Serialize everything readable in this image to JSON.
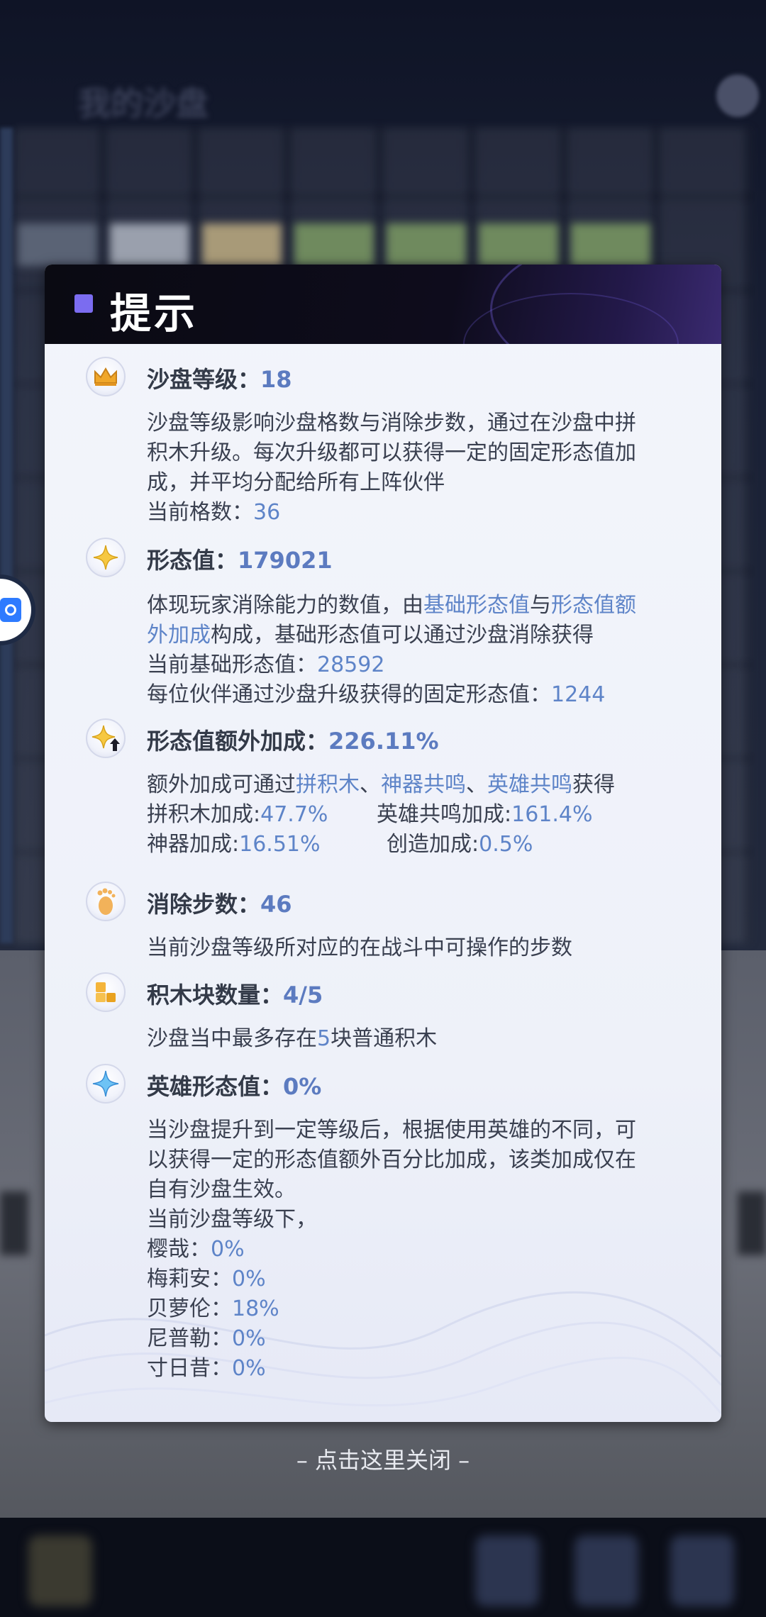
{
  "background": {
    "title": "我的沙盘",
    "help_icon": "question-icon"
  },
  "dialog": {
    "title": "提示",
    "sections": [
      {
        "icon": "crown-icon",
        "label": "沙盘等级：",
        "value": "18",
        "lines": [
          [
            "沙盘等级影响沙盘格数与消除步数，通过在沙盘中拼"
          ],
          [
            "积木升级。每次升级都可以获得一定的固定形态值加"
          ],
          [
            "成，并平均分配给所有上阵伙伴"
          ],
          [
            "当前格数：",
            "36"
          ]
        ]
      },
      {
        "icon": "sparkle-icon",
        "label": "形态值：",
        "value": "179021",
        "line1": {
          "a": "体现玩家消除能力的数值，由",
          "b": "基础形态值",
          "c": "与",
          "d": "形态值额"
        },
        "line2": {
          "a": "外加成",
          "b": "构成，基础形态值可以通过沙盘消除获得"
        },
        "line3": {
          "label": "当前基础形态值：",
          "value": "28592"
        },
        "line4": {
          "label": "每位伙伴通过沙盘升级获得的固定形态值：",
          "value": "1244"
        }
      },
      {
        "icon": "sparkle-up-icon",
        "label": "形态值额外加成：",
        "value": "226.11%",
        "line1": {
          "a": "额外加成可通过",
          "b": "拼积木",
          "c": "、",
          "d": "神器共鸣",
          "e": "、",
          "f": "英雄共鸣",
          "g": "获得"
        },
        "stats": [
          {
            "label": "拼积木加成:",
            "value": "47.7%"
          },
          {
            "label": "英雄共鸣加成:",
            "value": "161.4%"
          },
          {
            "label": "神器加成:",
            "value": "16.51%"
          },
          {
            "label": "创造加成:",
            "value": "0.5%"
          }
        ]
      },
      {
        "icon": "footprint-icon",
        "label": "消除步数：",
        "value": "46",
        "line1": "当前沙盘等级所对应的在战斗中可操作的步数"
      },
      {
        "icon": "blocks-icon",
        "label": "积木块数量：",
        "value": "4/5",
        "line1": {
          "a": "沙盘当中最多存在",
          "b": "5",
          "c": "块普通积木"
        }
      },
      {
        "icon": "star-crystal-icon",
        "label": "英雄形态值：",
        "value": "0%",
        "lines": [
          "当沙盘提升到一定等级后，根据使用英雄的不同，可",
          "以获得一定的形态值额外百分比加成，该类加成仅在",
          "自有沙盘生效。",
          "当前沙盘等级下，"
        ],
        "heroes": [
          {
            "name": "樱哉：",
            "value": "0%"
          },
          {
            "name": "梅莉安：",
            "value": "0%"
          },
          {
            "name": "贝萝伦：",
            "value": "18%"
          },
          {
            "name": "尼普勒：",
            "value": "0%"
          },
          {
            "name": "寸日昔：",
            "value": "0%"
          }
        ]
      }
    ]
  },
  "close_hint": "– 点击这里关闭 –",
  "colors": {
    "accent_value": "#5c7bc0",
    "link_blue": "#5e84c8",
    "title_square": "#7b6cf0"
  }
}
